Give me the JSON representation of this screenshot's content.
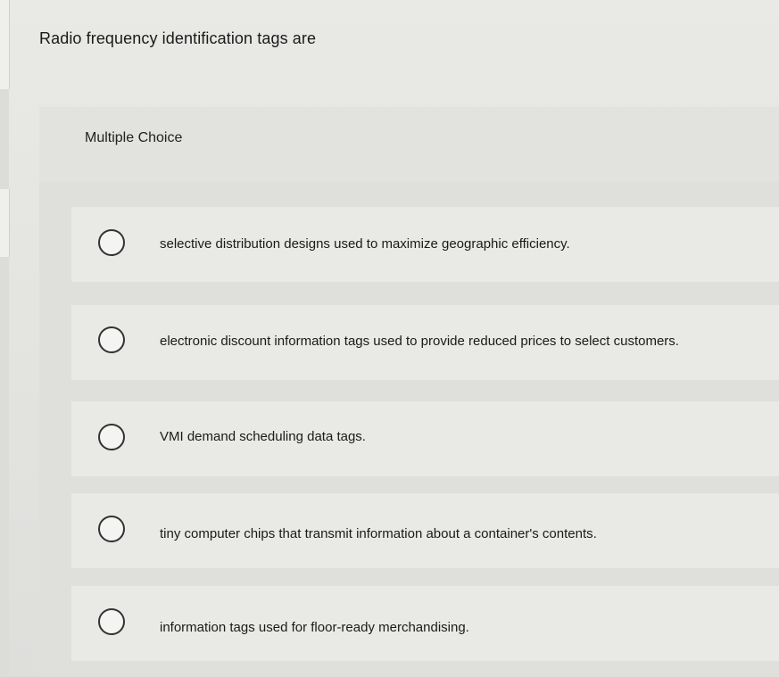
{
  "question": {
    "text": "Radio frequency identification tags are"
  },
  "choice_block": {
    "header": "Multiple Choice",
    "options": [
      {
        "label": "selective distribution designs used to maximize geographic efficiency."
      },
      {
        "label": "electronic discount information tags used to provide reduced prices to select customers."
      },
      {
        "label": "VMI demand scheduling data tags."
      },
      {
        "label": "tiny computer chips that transmit information about a container's contents."
      },
      {
        "label": "information tags used for floor-ready merchandising."
      }
    ]
  }
}
